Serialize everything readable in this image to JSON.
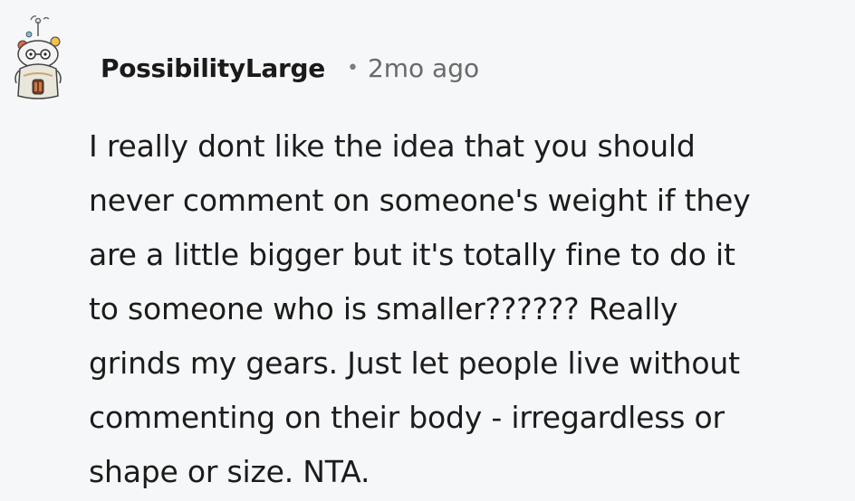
{
  "comment": {
    "username": "PossibilityLarge",
    "separator": "•",
    "timestamp": "2mo ago",
    "body_lines": [
      "I really dont like the idea that you should",
      "never comment on someone's weight if they",
      "are a little bigger but it's totally fine to do it",
      "to someone who is smaller?????? Really",
      "grinds my gears. Just let people live without",
      "commenting on their body - irregardless or",
      "shape or size. NTA."
    ]
  },
  "colors": {
    "background": "#f6f7f8",
    "username": "#1a1a1b",
    "timestamp": "#6a6a6a",
    "body": "#1c1c1c"
  },
  "icons": {
    "avatar": "snoo-avatar-icon"
  }
}
